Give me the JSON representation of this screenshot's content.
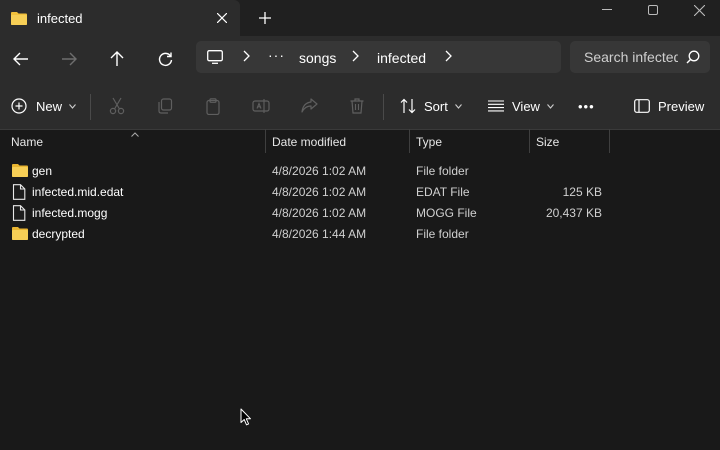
{
  "window": {
    "tab_title": "infected",
    "new_tab_label": "+"
  },
  "nav": {
    "breadcrumb": [
      "songs",
      "infected"
    ],
    "overflow": "···",
    "search_placeholder": "Search infected"
  },
  "toolbar": {
    "new_label": "New",
    "sort_label": "Sort",
    "view_label": "View",
    "more_label": "•••",
    "preview_label": "Preview"
  },
  "columns": {
    "name": "Name",
    "date": "Date modified",
    "type": "Type",
    "size": "Size"
  },
  "files": [
    {
      "name": "gen",
      "date": "4/8/2026 1:02 AM",
      "type": "File folder",
      "size": "",
      "icon": "folder-icon"
    },
    {
      "name": "infected.mid.edat",
      "date": "4/8/2026 1:02 AM",
      "type": "EDAT File",
      "size": "125 KB",
      "icon": "file-icon"
    },
    {
      "name": "infected.mogg",
      "date": "4/8/2026 1:02 AM",
      "type": "MOGG File",
      "size": "20,437 KB",
      "icon": "file-icon"
    },
    {
      "name": "decrypted",
      "date": "4/8/2026 1:44 AM",
      "type": "File folder",
      "size": "",
      "icon": "folder-icon"
    }
  ],
  "colors": {
    "background": "#191919",
    "chrome": "#2c2c2c",
    "folder": "#f2c13c",
    "text": "#ffffff",
    "muted": "#d0d0d0"
  }
}
